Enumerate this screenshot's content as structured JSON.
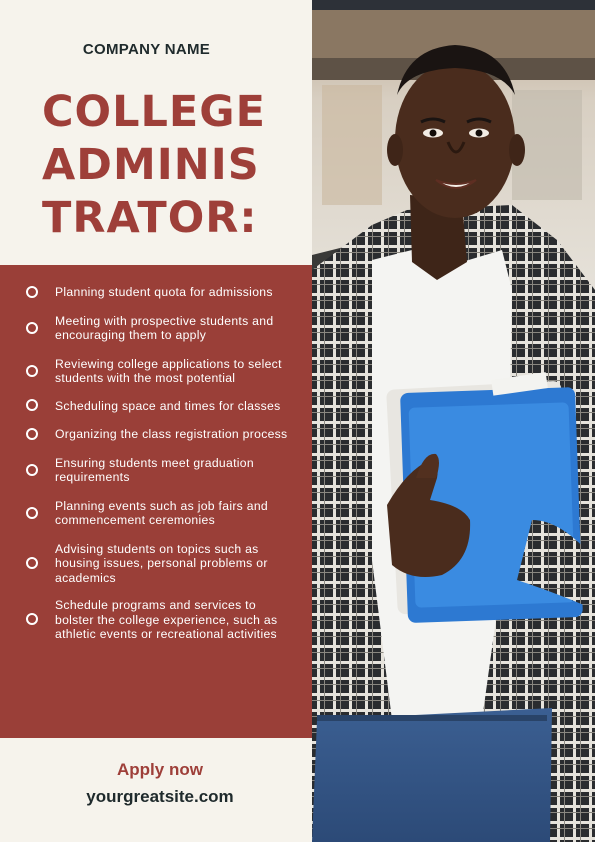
{
  "header": {
    "company_name": "COMPANY NAME",
    "title_lines": [
      "COLLEGE",
      "ADMINIS",
      "TRATOR:"
    ]
  },
  "duties": [
    "Planning student quota for admissions",
    "Meeting with prospective students and encouraging them to apply",
    "Reviewing college applications to select students with the most potential",
    "Scheduling space and times for classes",
    "Organizing the class registration process",
    "Ensuring students meet graduation requirements",
    "Planning events such as job fairs and commencement ceremonies",
    "Advising students on topics such as housing issues, personal problems or academics",
    "Schedule programs and services to bolster the college experience, such as athletic events or recreational activities"
  ],
  "footer": {
    "apply_label": "Apply now",
    "website": "yourgreatsite.com"
  },
  "photo": {
    "subject": "student holding blue folders"
  },
  "colors": {
    "accent": "#9e3f39",
    "panel": "#9a3f38",
    "background": "#f6f3ec",
    "dark_text": "#1f2a2c"
  }
}
